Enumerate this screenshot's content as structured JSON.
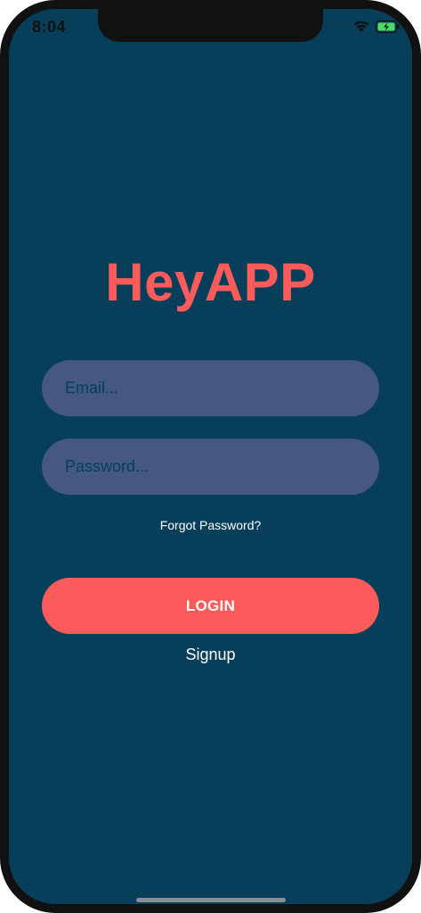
{
  "status_bar": {
    "time": "8:04",
    "icons": [
      "cellular-signal-icon",
      "wifi-icon",
      "battery-charging-icon"
    ]
  },
  "app": {
    "title": "HeyAPP"
  },
  "form": {
    "email_placeholder": "Email...",
    "password_placeholder": "Password...",
    "forgot_label": "Forgot Password?",
    "login_label": "LOGIN",
    "signup_label": "Signup"
  },
  "colors": {
    "background": "#073f5a",
    "accent": "#fb5b5a",
    "input_background": "#465881",
    "input_text": "#003f5c"
  }
}
